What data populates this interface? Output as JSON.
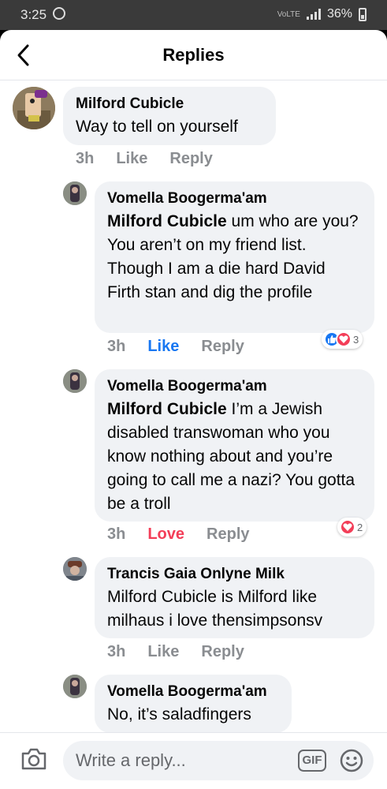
{
  "status_bar": {
    "time": "3:25",
    "network": "VoLTE",
    "battery": "36%"
  },
  "header": {
    "title": "Replies"
  },
  "comments": [
    {
      "author": "Milford Cubicle",
      "text": "Way to tell on yourself",
      "time": "3h",
      "like": "Like",
      "reply": "Reply"
    },
    {
      "author": "Vomella Boogerma'am",
      "mention": "Milford Cubicle",
      "text": "um who are you? You aren’t on my friend list. Though I am a die hard David Firth stan and dig the profile",
      "time": "3h",
      "like": "Like",
      "reply": "Reply",
      "reaction_count": "3"
    },
    {
      "author": "Vomella Boogerma'am",
      "mention": "Milford Cubicle",
      "text": "I’m a Jewish disabled transwoman who you know nothing about and you’re going to call me a nazi? You gotta be a troll",
      "time": "3h",
      "like": "Love",
      "reply": "Reply",
      "reaction_count": "2"
    },
    {
      "author": "Trancis Gaia Onlyne Milk",
      "text": "Milford Cubicle is Milford like milhaus i love thensimpsonsv",
      "time": "3h",
      "like": "Like",
      "reply": "Reply"
    },
    {
      "author": "Vomella Boogerma'am",
      "text": "No, it’s saladfingers"
    }
  ],
  "composer": {
    "placeholder": "Write a reply...",
    "gif_label": "GIF"
  },
  "colors": {
    "accent": "#1877f2",
    "love": "#f33e58",
    "bubble": "#f0f2f5",
    "meta": "#8a8d91"
  },
  "icons": [
    "back-arrow-icon",
    "camera-icon",
    "gif-icon",
    "emoji-icon",
    "like-reaction-icon",
    "love-reaction-icon"
  ]
}
